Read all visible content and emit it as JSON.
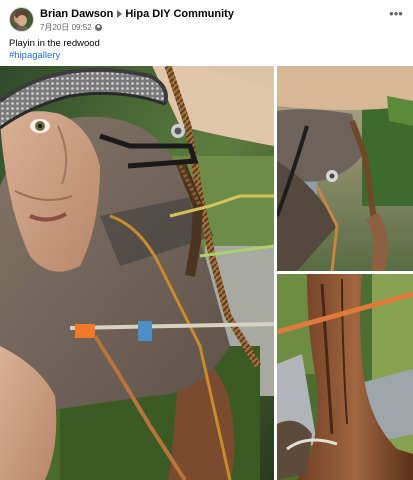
{
  "post": {
    "author": "Brian Dawson",
    "group": "Hipa DIY Community",
    "timestamp": "7月20日 09:52",
    "more_icon": "•••",
    "caption": "Playin in the redwood",
    "hashtag": "#hipagallery",
    "privacy_icon": "globe-icon"
  },
  "colors": {
    "hashtag_link": "#216fdb",
    "meta_text": "#65676b"
  }
}
